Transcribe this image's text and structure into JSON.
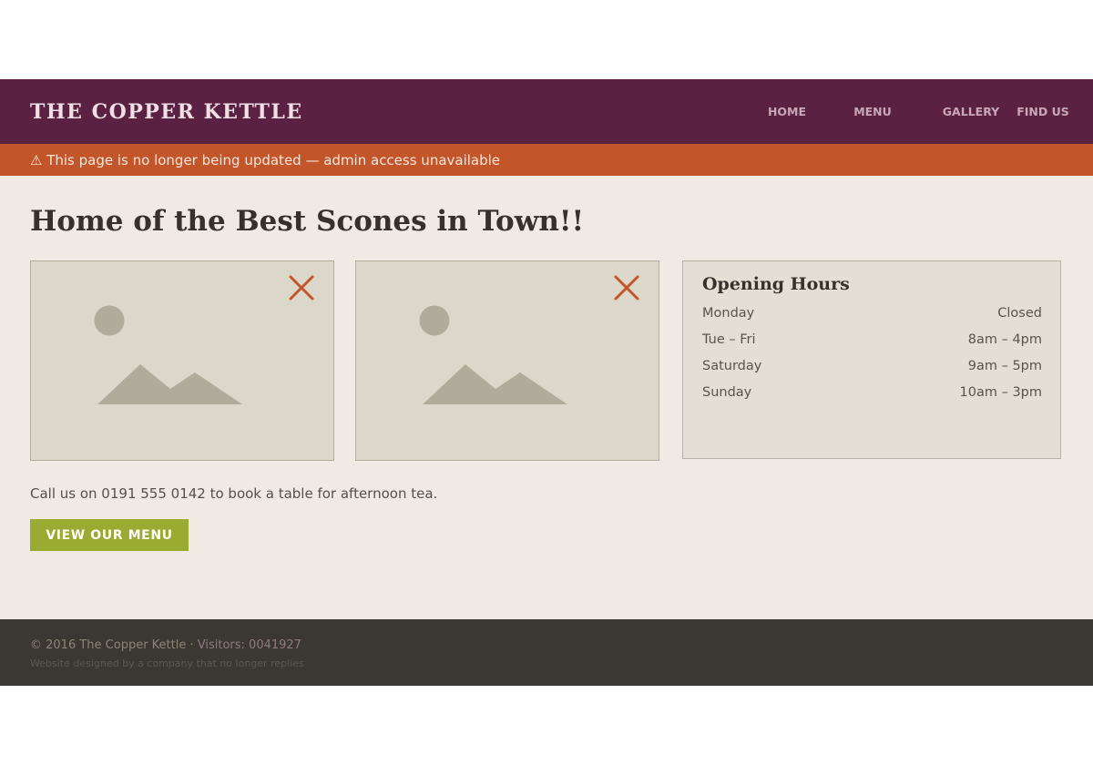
{
  "header": {
    "brand": "THE COPPER KETTLE",
    "nav": [
      "HOME",
      "MENU",
      "GALLERY",
      "FIND US"
    ]
  },
  "banner": {
    "icon": "warning-icon",
    "text": "⚠ This page is no longer being updated — admin access unavailable"
  },
  "main": {
    "headline": "Home of the Best Scones in Town!!",
    "images": [
      {
        "icon": "broken-image-icon"
      },
      {
        "icon": "broken-image-icon"
      }
    ],
    "hours": {
      "title": "Opening Hours",
      "rows": [
        {
          "day": "Monday",
          "time": "Closed"
        },
        {
          "day": "Tue – Fri",
          "time": "8am – 4pm"
        },
        {
          "day": "Saturday",
          "time": "9am – 5pm"
        },
        {
          "day": "Sunday",
          "time": "10am – 3pm"
        }
      ]
    },
    "call_text": "Call us on 0191 555 0142 to book a table for afternoon tea.",
    "menu_button": "VIEW OUR MENU"
  },
  "footer": {
    "copyright": "© 2016 The Copper Kettle ·",
    "visitors": "Visitors: 0041927",
    "credit": "Website designed by a company that no longer replies"
  },
  "colors": {
    "header_bg": "#5b2142",
    "banner_bg": "#c2552a",
    "content_bg": "#efebe4",
    "button_bg": "#9aab31",
    "footer_bg": "#3b3732"
  }
}
